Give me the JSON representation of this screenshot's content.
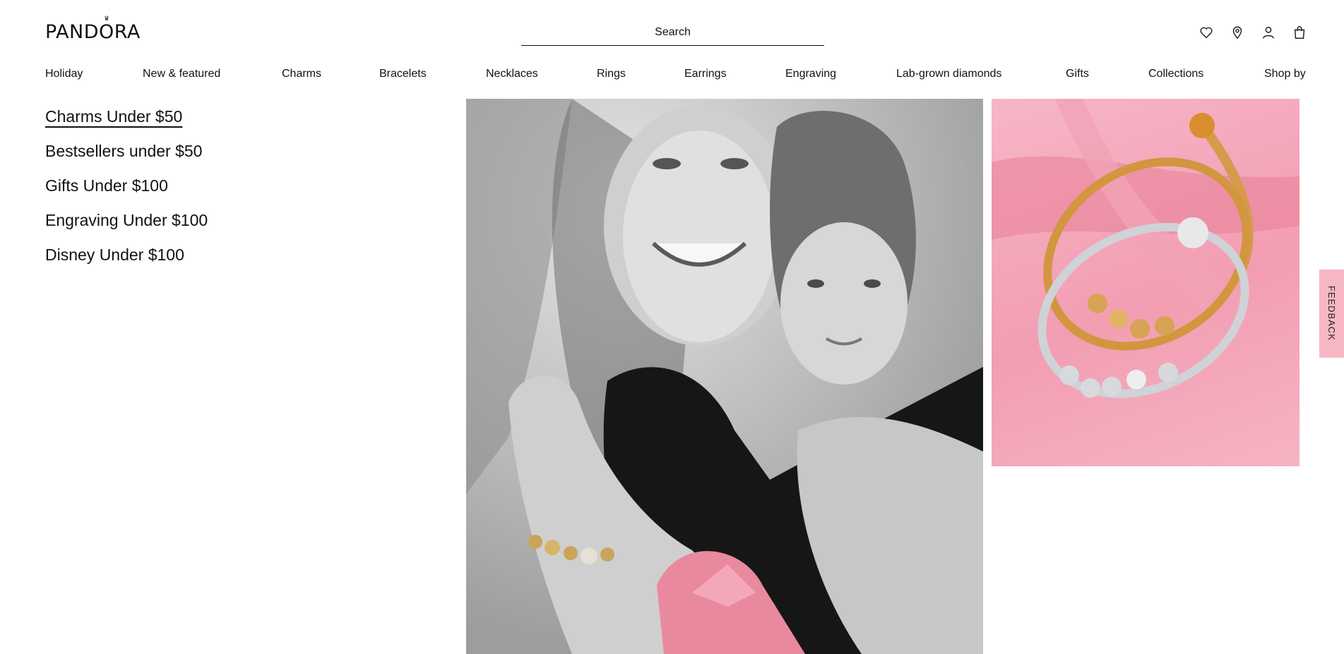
{
  "header": {
    "logo_text": "PANDORA",
    "search_label": "Search",
    "icons": [
      "heart-icon",
      "location-pin-icon",
      "user-icon",
      "shopping-bag-icon"
    ]
  },
  "nav": {
    "items": [
      "Holiday",
      "New & featured",
      "Charms",
      "Bracelets",
      "Necklaces",
      "Rings",
      "Earrings",
      "Engraving",
      "Lab-grown diamonds",
      "Gifts",
      "Collections",
      "Shop by"
    ]
  },
  "submenu": {
    "items": [
      "Charms Under $50",
      "Bestsellers under $50",
      "Gifts Under $100",
      "Engraving Under $100",
      "Disney Under $100"
    ],
    "active_index": 0
  },
  "feedback": {
    "label": "FEEDBACK",
    "color": "#f8b7c5"
  },
  "colors": {
    "text": "#111111",
    "pink_accent": "#f39db2"
  }
}
